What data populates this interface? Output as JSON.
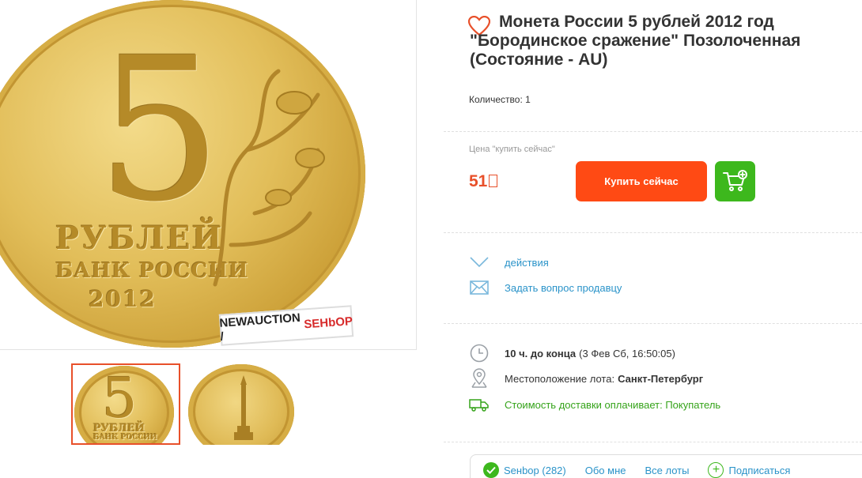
{
  "gallery": {
    "main": {
      "denomination": "5",
      "rubles": "РУБЛЕЙ",
      "bank": "БАНК РОССИИ",
      "year": "2012",
      "watermark_part1": "NEWAUCTION /",
      "watermark_part2": "SEHbOP"
    },
    "thumbnails": [
      {
        "denomination": "5",
        "rubles": "РУБЛЕЙ",
        "bank": "БАНК РОССИИ",
        "active": true
      },
      {
        "active": false
      }
    ]
  },
  "lot": {
    "title": "Монета России 5 рублей 2012 год \"Бородинское сражение\" Позолоченная (Состояние - AU)",
    "quantity_label": "Количество:",
    "quantity_value": "1",
    "price_label": "Цена \"купить сейчас\"",
    "price": "51",
    "buy_button": "Купить сейчас"
  },
  "actions": {
    "actions_link": "действия",
    "ask_seller_link": "Задать вопрос продавцу"
  },
  "info": {
    "time_left": "10 ч. до конца",
    "end_date": "(3 Фев Сб, 16:50:05)",
    "location_label": "Местоположение лота:",
    "location_value": "Санкт-Петербург",
    "shipping": "Стоимость доставки оплачивает: Покупатель"
  },
  "seller": {
    "name": "Seнbор (282)",
    "about": "Обо мне",
    "all_lots": "Все лоты",
    "subscribe": "Подписаться"
  },
  "colors": {
    "accent_orange": "#ff4a14",
    "price": "#e8502a",
    "green": "#3db81d",
    "link": "#2a93c9"
  }
}
